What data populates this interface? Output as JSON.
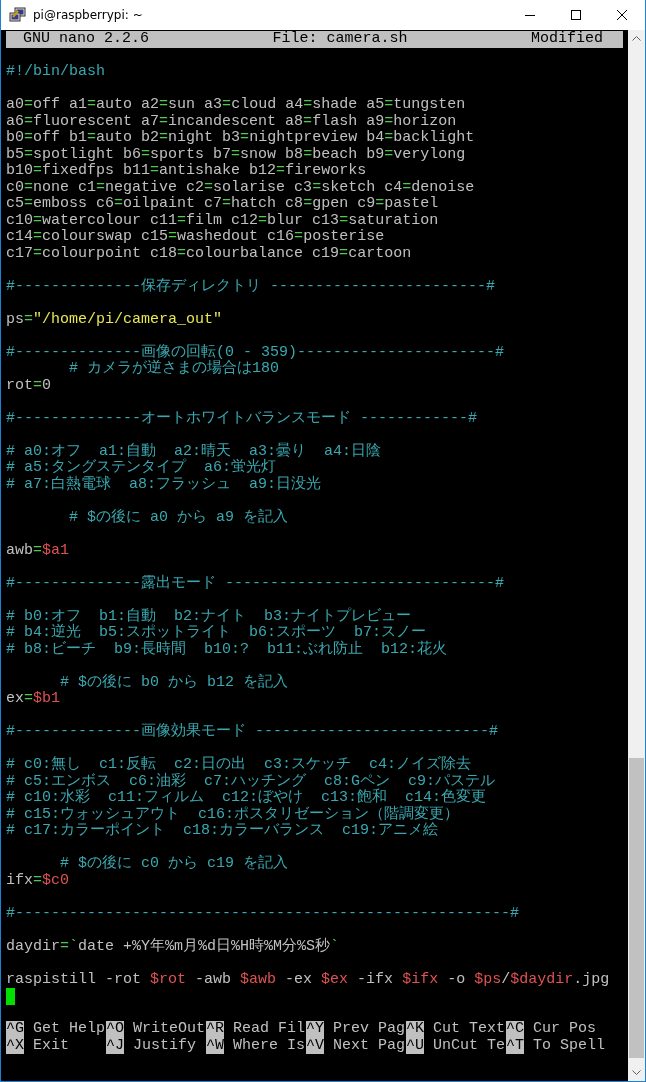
{
  "window": {
    "title": "pi@raspberrypi: ~"
  },
  "nano_header": {
    "version": "GNU nano 2.2.6",
    "file": "File: camera.sh",
    "status": "Modified"
  },
  "lines": [
    {
      "kind": "blank"
    },
    {
      "kind": "code",
      "segments": [
        {
          "kind": "comment",
          "text": "#!/bin/bash"
        }
      ]
    },
    {
      "kind": "blank"
    },
    {
      "kind": "code",
      "segments": [
        {
          "kind": "plain",
          "text": "a0"
        },
        {
          "kind": "op",
          "text": "="
        },
        {
          "kind": "plain",
          "text": "off a1"
        },
        {
          "kind": "op",
          "text": "="
        },
        {
          "kind": "plain",
          "text": "auto a2"
        },
        {
          "kind": "op",
          "text": "="
        },
        {
          "kind": "plain",
          "text": "sun a3"
        },
        {
          "kind": "op",
          "text": "="
        },
        {
          "kind": "plain",
          "text": "cloud a4"
        },
        {
          "kind": "op",
          "text": "="
        },
        {
          "kind": "plain",
          "text": "shade a5"
        },
        {
          "kind": "op",
          "text": "="
        },
        {
          "kind": "plain",
          "text": "tungsten"
        }
      ]
    },
    {
      "kind": "code",
      "segments": [
        {
          "kind": "plain",
          "text": "a6"
        },
        {
          "kind": "op",
          "text": "="
        },
        {
          "kind": "plain",
          "text": "fluorescent a7"
        },
        {
          "kind": "op",
          "text": "="
        },
        {
          "kind": "plain",
          "text": "incandescent a8"
        },
        {
          "kind": "op",
          "text": "="
        },
        {
          "kind": "plain",
          "text": "flash a9"
        },
        {
          "kind": "op",
          "text": "="
        },
        {
          "kind": "plain",
          "text": "horizon"
        }
      ]
    },
    {
      "kind": "code",
      "segments": [
        {
          "kind": "plain",
          "text": "b0"
        },
        {
          "kind": "op",
          "text": "="
        },
        {
          "kind": "plain",
          "text": "off b1"
        },
        {
          "kind": "op",
          "text": "="
        },
        {
          "kind": "plain",
          "text": "auto b2"
        },
        {
          "kind": "op",
          "text": "="
        },
        {
          "kind": "plain",
          "text": "night b3"
        },
        {
          "kind": "op",
          "text": "="
        },
        {
          "kind": "plain",
          "text": "nightpreview b4"
        },
        {
          "kind": "op",
          "text": "="
        },
        {
          "kind": "plain",
          "text": "backlight"
        }
      ]
    },
    {
      "kind": "code",
      "segments": [
        {
          "kind": "plain",
          "text": "b5"
        },
        {
          "kind": "op",
          "text": "="
        },
        {
          "kind": "plain",
          "text": "spotlight b6"
        },
        {
          "kind": "op",
          "text": "="
        },
        {
          "kind": "plain",
          "text": "sports b7"
        },
        {
          "kind": "op",
          "text": "="
        },
        {
          "kind": "plain",
          "text": "snow b8"
        },
        {
          "kind": "op",
          "text": "="
        },
        {
          "kind": "plain",
          "text": "beach b9"
        },
        {
          "kind": "op",
          "text": "="
        },
        {
          "kind": "plain",
          "text": "verylong"
        }
      ]
    },
    {
      "kind": "code",
      "segments": [
        {
          "kind": "plain",
          "text": "b10"
        },
        {
          "kind": "op",
          "text": "="
        },
        {
          "kind": "plain",
          "text": "fixedfps b11"
        },
        {
          "kind": "op",
          "text": "="
        },
        {
          "kind": "plain",
          "text": "antishake b12"
        },
        {
          "kind": "op",
          "text": "="
        },
        {
          "kind": "plain",
          "text": "fireworks"
        }
      ]
    },
    {
      "kind": "code",
      "segments": [
        {
          "kind": "plain",
          "text": "c0"
        },
        {
          "kind": "op",
          "text": "="
        },
        {
          "kind": "plain",
          "text": "none c1"
        },
        {
          "kind": "op",
          "text": "="
        },
        {
          "kind": "plain",
          "text": "negative c2"
        },
        {
          "kind": "op",
          "text": "="
        },
        {
          "kind": "plain",
          "text": "solarise c3"
        },
        {
          "kind": "op",
          "text": "="
        },
        {
          "kind": "plain",
          "text": "sketch c4"
        },
        {
          "kind": "op",
          "text": "="
        },
        {
          "kind": "plain",
          "text": "denoise"
        }
      ]
    },
    {
      "kind": "code",
      "segments": [
        {
          "kind": "plain",
          "text": "c5"
        },
        {
          "kind": "op",
          "text": "="
        },
        {
          "kind": "plain",
          "text": "emboss c6"
        },
        {
          "kind": "op",
          "text": "="
        },
        {
          "kind": "plain",
          "text": "oilpaint c7"
        },
        {
          "kind": "op",
          "text": "="
        },
        {
          "kind": "plain",
          "text": "hatch c8"
        },
        {
          "kind": "op",
          "text": "="
        },
        {
          "kind": "plain",
          "text": "gpen c9"
        },
        {
          "kind": "op",
          "text": "="
        },
        {
          "kind": "plain",
          "text": "pastel"
        }
      ]
    },
    {
      "kind": "code",
      "segments": [
        {
          "kind": "plain",
          "text": "c10"
        },
        {
          "kind": "op",
          "text": "="
        },
        {
          "kind": "plain",
          "text": "watercolour c11"
        },
        {
          "kind": "op",
          "text": "="
        },
        {
          "kind": "plain",
          "text": "film c12"
        },
        {
          "kind": "op",
          "text": "="
        },
        {
          "kind": "plain",
          "text": "blur c13"
        },
        {
          "kind": "op",
          "text": "="
        },
        {
          "kind": "plain",
          "text": "saturation"
        }
      ]
    },
    {
      "kind": "code",
      "segments": [
        {
          "kind": "plain",
          "text": "c14"
        },
        {
          "kind": "op",
          "text": "="
        },
        {
          "kind": "plain",
          "text": "colourswap c15"
        },
        {
          "kind": "op",
          "text": "="
        },
        {
          "kind": "plain",
          "text": "washedout c16"
        },
        {
          "kind": "op",
          "text": "="
        },
        {
          "kind": "plain",
          "text": "posterise"
        }
      ]
    },
    {
      "kind": "code",
      "segments": [
        {
          "kind": "plain",
          "text": "c17"
        },
        {
          "kind": "op",
          "text": "="
        },
        {
          "kind": "plain",
          "text": "colourpoint c18"
        },
        {
          "kind": "op",
          "text": "="
        },
        {
          "kind": "plain",
          "text": "colourbalance c19"
        },
        {
          "kind": "op",
          "text": "="
        },
        {
          "kind": "plain",
          "text": "cartoon"
        }
      ]
    },
    {
      "kind": "blank"
    },
    {
      "kind": "code",
      "segments": [
        {
          "kind": "comment",
          "text": "#--------------保存ディレクトリ ------------------------#"
        }
      ]
    },
    {
      "kind": "blank"
    },
    {
      "kind": "code",
      "segments": [
        {
          "kind": "plain",
          "text": "ps"
        },
        {
          "kind": "op",
          "text": "="
        },
        {
          "kind": "string",
          "text": "\"/home/pi/camera_out\""
        }
      ]
    },
    {
      "kind": "blank"
    },
    {
      "kind": "code",
      "segments": [
        {
          "kind": "comment",
          "text": "#--------------画像の回転(0 - 359)----------------------#"
        }
      ]
    },
    {
      "kind": "code",
      "segments": [
        {
          "kind": "comment",
          "text": "       # カメラが逆さまの場合は180"
        }
      ]
    },
    {
      "kind": "code",
      "segments": [
        {
          "kind": "plain",
          "text": "rot"
        },
        {
          "kind": "op",
          "text": "="
        },
        {
          "kind": "plain",
          "text": "0"
        }
      ]
    },
    {
      "kind": "blank"
    },
    {
      "kind": "code",
      "segments": [
        {
          "kind": "comment",
          "text": "#--------------オートホワイトバランスモード ------------#"
        }
      ]
    },
    {
      "kind": "blank"
    },
    {
      "kind": "code",
      "segments": [
        {
          "kind": "comment",
          "text": "# a0:オフ  a1:自動  a2:晴天  a3:曇り  a4:日陰"
        }
      ]
    },
    {
      "kind": "code",
      "segments": [
        {
          "kind": "comment",
          "text": "# a5:タングステンタイプ  a6:蛍光灯"
        }
      ]
    },
    {
      "kind": "code",
      "segments": [
        {
          "kind": "comment",
          "text": "# a7:白熱電球  a8:フラッシュ  a9:日没光"
        }
      ]
    },
    {
      "kind": "blank"
    },
    {
      "kind": "code",
      "segments": [
        {
          "kind": "comment",
          "text": "       # $の後に a0 から a9 を記入"
        }
      ]
    },
    {
      "kind": "blank"
    },
    {
      "kind": "code",
      "segments": [
        {
          "kind": "plain",
          "text": "awb"
        },
        {
          "kind": "op",
          "text": "="
        },
        {
          "kind": "var",
          "text": "$a1"
        }
      ]
    },
    {
      "kind": "blank"
    },
    {
      "kind": "code",
      "segments": [
        {
          "kind": "comment",
          "text": "#--------------露出モード ------------------------------#"
        }
      ]
    },
    {
      "kind": "blank"
    },
    {
      "kind": "code",
      "segments": [
        {
          "kind": "comment",
          "text": "# b0:オフ  b1:自動  b2:ナイト  b3:ナイトプレビュー"
        }
      ]
    },
    {
      "kind": "code",
      "segments": [
        {
          "kind": "comment",
          "text": "# b4:逆光  b5:スポットライト  b6:スポーツ  b7:スノー"
        }
      ]
    },
    {
      "kind": "code",
      "segments": [
        {
          "kind": "comment",
          "text": "# b8:ビーチ  b9:長時間  b10:?  b11:ぶれ防止  b12:花火"
        }
      ]
    },
    {
      "kind": "blank"
    },
    {
      "kind": "code",
      "segments": [
        {
          "kind": "comment",
          "text": "      # $の後に b0 から b12 を記入"
        }
      ]
    },
    {
      "kind": "code",
      "segments": [
        {
          "kind": "plain",
          "text": "ex"
        },
        {
          "kind": "op",
          "text": "="
        },
        {
          "kind": "var",
          "text": "$b1"
        }
      ]
    },
    {
      "kind": "blank"
    },
    {
      "kind": "code",
      "segments": [
        {
          "kind": "comment",
          "text": "#--------------画像効果モード --------------------------#"
        }
      ]
    },
    {
      "kind": "blank"
    },
    {
      "kind": "code",
      "segments": [
        {
          "kind": "comment",
          "text": "# c0:無し  c1:反転  c2:日の出  c3:スケッチ  c4:ノイズ除去"
        }
      ]
    },
    {
      "kind": "code",
      "segments": [
        {
          "kind": "comment",
          "text": "# c5:エンボス  c6:油彩  c7:ハッチング  c8:Gペン  c9:パステル"
        }
      ]
    },
    {
      "kind": "code",
      "segments": [
        {
          "kind": "comment",
          "text": "# c10:水彩  c11:フィルム  c12:ぼやけ  c13:飽和  c14:色変更"
        }
      ]
    },
    {
      "kind": "code",
      "segments": [
        {
          "kind": "comment",
          "text": "# c15:ウォッシュアウト  c16:ポスタリゼーション（階調変更）"
        }
      ]
    },
    {
      "kind": "code",
      "segments": [
        {
          "kind": "comment",
          "text": "# c17:カラーポイント  c18:カラーバランス  c19:アニメ絵"
        }
      ]
    },
    {
      "kind": "blank"
    },
    {
      "kind": "code",
      "segments": [
        {
          "kind": "comment",
          "text": "      # $の後に c0 から c19 を記入"
        }
      ]
    },
    {
      "kind": "code",
      "segments": [
        {
          "kind": "plain",
          "text": "ifx"
        },
        {
          "kind": "op",
          "text": "="
        },
        {
          "kind": "var",
          "text": "$c0"
        }
      ]
    },
    {
      "kind": "blank"
    },
    {
      "kind": "code",
      "segments": [
        {
          "kind": "comment",
          "text": "#-------------------------------------------------------#"
        }
      ]
    },
    {
      "kind": "blank"
    },
    {
      "kind": "code",
      "segments": [
        {
          "kind": "plain",
          "text": "daydir"
        },
        {
          "kind": "op",
          "text": "=`"
        },
        {
          "kind": "plain",
          "text": "date +%Y年%m月%d日%H時%M分%S秒"
        },
        {
          "kind": "op",
          "text": "`"
        }
      ]
    },
    {
      "kind": "blank"
    },
    {
      "kind": "code",
      "segments": [
        {
          "kind": "plain",
          "text": "raspistill -rot "
        },
        {
          "kind": "var",
          "text": "$rot"
        },
        {
          "kind": "plain",
          "text": " -awb "
        },
        {
          "kind": "var",
          "text": "$awb"
        },
        {
          "kind": "plain",
          "text": " -ex "
        },
        {
          "kind": "var",
          "text": "$ex"
        },
        {
          "kind": "plain",
          "text": " -ifx "
        },
        {
          "kind": "var",
          "text": "$ifx"
        },
        {
          "kind": "plain",
          "text": " -o "
        },
        {
          "kind": "var",
          "text": "$ps"
        },
        {
          "kind": "plain",
          "text": "/"
        },
        {
          "kind": "var",
          "text": "$daydir"
        },
        {
          "kind": "plain",
          "text": ".jpg"
        }
      ]
    },
    {
      "kind": "cursor"
    },
    {
      "kind": "blank"
    }
  ],
  "shortcuts": [
    [
      {
        "key": "^G",
        "label": "Get Help"
      },
      {
        "key": "^O",
        "label": "WriteOut"
      },
      {
        "key": "^R",
        "label": "Read Fil"
      },
      {
        "key": "^Y",
        "label": "Prev Pag"
      },
      {
        "key": "^K",
        "label": "Cut Text"
      },
      {
        "key": "^C",
        "label": "Cur Pos"
      }
    ],
    [
      {
        "key": "^X",
        "label": "Exit"
      },
      {
        "key": "^J",
        "label": "Justify"
      },
      {
        "key": "^W",
        "label": "Where Is"
      },
      {
        "key": "^V",
        "label": "Next Pag"
      },
      {
        "key": "^U",
        "label": "UnCut Te"
      },
      {
        "key": "^T",
        "label": "To Spell"
      }
    ]
  ]
}
